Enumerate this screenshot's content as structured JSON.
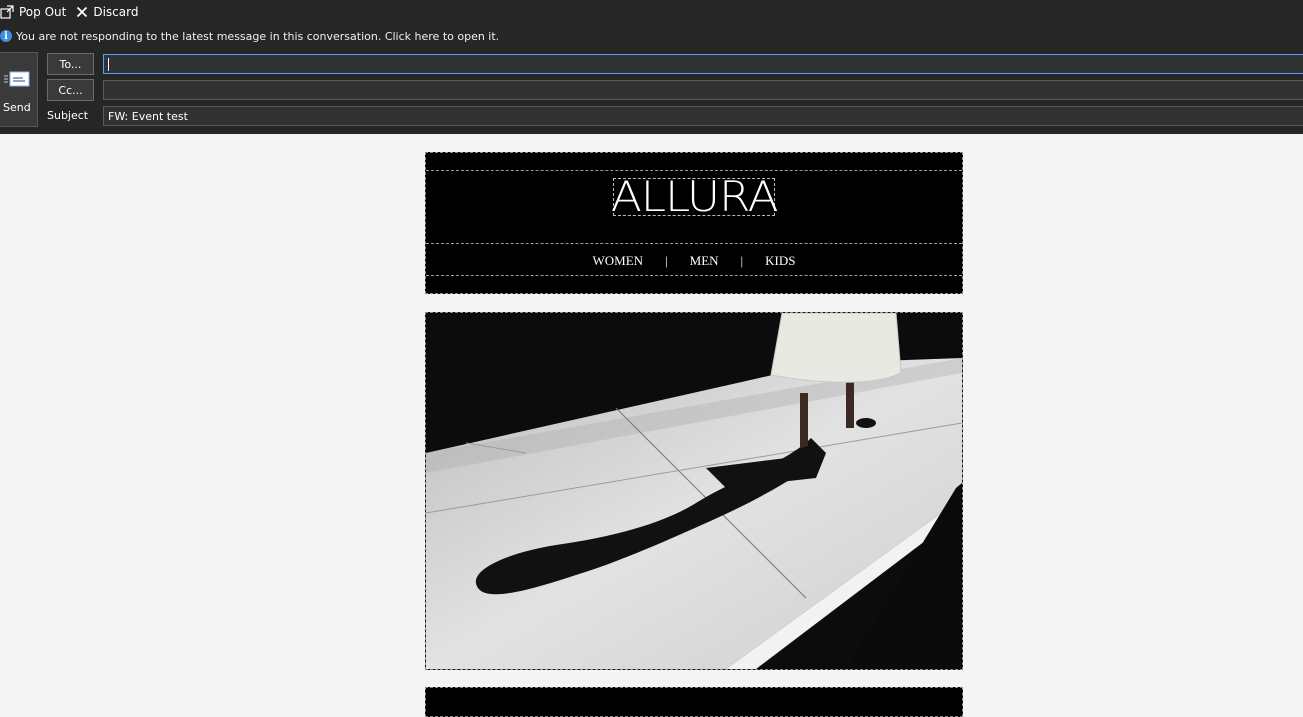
{
  "toolbar": {
    "pop_out_label": "Pop Out",
    "discard_label": "Discard"
  },
  "infobar": {
    "message": "You are not responding to the latest message in this conversation. Click here to open it."
  },
  "compose": {
    "send_label": "Send",
    "to_button_label": "To...",
    "cc_button_label": "Cc...",
    "subject_label": "Subject",
    "to_value": "",
    "cc_value": "",
    "subject_value": "FW: Event test"
  },
  "email": {
    "brand_logo": "ALLURA",
    "nav": [
      {
        "label": "WOMEN"
      },
      {
        "label": "MEN"
      },
      {
        "label": "KIDS"
      }
    ],
    "nav_separator": "|"
  },
  "icons": {
    "pop_out": "pop-out-icon",
    "discard": "close-icon",
    "info": "info-icon",
    "send": "envelope-send-icon"
  },
  "colors": {
    "header_bg": "#262626",
    "body_bg": "#f4f4f4",
    "info_blue": "#3d8fe0",
    "focus_blue": "#4aa3ff"
  }
}
